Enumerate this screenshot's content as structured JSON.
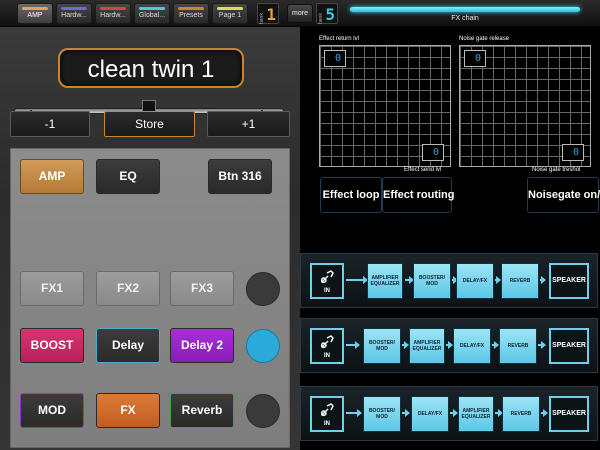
{
  "colors": {
    "accent_orange": "#c9842e",
    "cyan": "#3ec8e8",
    "pink": "#cc2b66",
    "purple": "#9b22c9",
    "orange": "#d06a2c",
    "green": "#2d8d3a"
  },
  "topbar": {
    "tabs": [
      {
        "label": "AMP",
        "stripe": "#e3a64a"
      },
      {
        "label": "Hardw...",
        "stripe": "#6b6bd8"
      },
      {
        "label": "Hardw...",
        "stripe": "#c84a4a"
      },
      {
        "label": "Global...",
        "stripe": "#4ad0c6"
      },
      {
        "label": "Presets",
        "stripe": "#c9842e"
      },
      {
        "label": "Page 1",
        "stripe": "#d8e04a"
      }
    ],
    "bank1": {
      "label": "bank",
      "value": "1",
      "color": "#e3a03a"
    },
    "more": "more",
    "bank2": {
      "label": "bank",
      "value": "5",
      "color": "#3ec8e8"
    },
    "fx_chain_label": "FX chain"
  },
  "left": {
    "preset_name": "clean twin 1",
    "minus_label": "-1",
    "store_label": "Store",
    "plus_label": "+1",
    "grid": {
      "amp": "AMP",
      "eq": "EQ",
      "btn316": "Btn 316",
      "fx1": "FX1",
      "fx2": "FX2",
      "fx3": "FX3",
      "boost": "BOOST",
      "delay": "Delay",
      "delay2": "Delay 2",
      "mod": "MOD",
      "fx": "FX",
      "reverb": "Reverb"
    }
  },
  "right": {
    "pad1": {
      "top_label": "Effect return lvl",
      "bottom_label": "Effect send lvl",
      "value_top": "0",
      "value_bottom": "0"
    },
    "pad2": {
      "top_label": "Noise gate release",
      "bottom_label": "Noise gate treshol",
      "value_top": "0",
      "value_bottom": "0"
    },
    "effect_loop": "Effect loop",
    "effect_routing": "Effect routing",
    "noisegate": "Noisegate on/off",
    "chains": [
      [
        "IN",
        "AMPLIFIER EQUALIZER",
        "BOOSTER/ MOD",
        "DELAY/FX",
        "REVERB",
        "SPEAKER"
      ],
      [
        "IN",
        "BOOSTER/ MOD",
        "AMPLIFIER EQUALIZER",
        "DELAY/FX",
        "REVERB",
        "SPEAKER"
      ],
      [
        "IN",
        "BOOSTER/ MOD",
        "DELAY/FX",
        "AMPLIFIER EQUALIZER",
        "REVERB",
        "SPEAKER"
      ]
    ]
  }
}
